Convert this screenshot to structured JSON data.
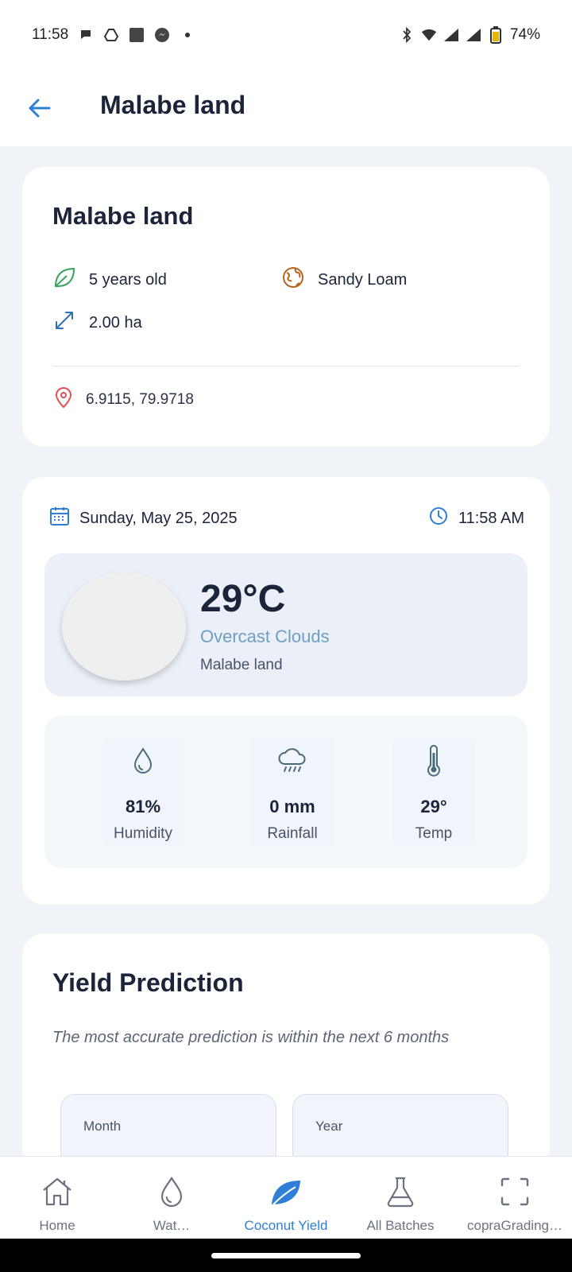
{
  "status_bar": {
    "time": "11:58",
    "battery": "74%"
  },
  "app_bar": {
    "title": "Malabe land"
  },
  "land_card": {
    "title": "Malabe land",
    "age": "5 years old",
    "soil": "Sandy Loam",
    "area": "2.00 ha",
    "coordinates": "6.9115, 79.9718"
  },
  "weather_card": {
    "date": "Sunday, May 25, 2025",
    "time": "11:58 AM",
    "temperature": "29°C",
    "description": "Overcast Clouds",
    "location": "Malabe land",
    "stats": [
      {
        "value": "81%",
        "label": "Humidity",
        "icon": "droplet-icon"
      },
      {
        "value": "0 mm",
        "label": "Rainfall",
        "icon": "rain-cloud-icon"
      },
      {
        "value": "29°",
        "label": "Temp",
        "icon": "thermometer-icon"
      }
    ]
  },
  "yield_card": {
    "title": "Yield Prediction",
    "note": "The most accurate prediction is within the next 6 months",
    "month_label": "Month",
    "year_label": "Year"
  },
  "bottom_nav": {
    "items": [
      {
        "label": "Home",
        "icon": "home-icon"
      },
      {
        "label": "Wat…",
        "icon": "water-drop-icon"
      },
      {
        "label": "Coconut Yield",
        "icon": "leaf-icon",
        "active": true
      },
      {
        "label": "All Batches",
        "icon": "flask-icon"
      },
      {
        "label": "copraGrading…",
        "icon": "scan-icon"
      }
    ]
  },
  "colors": {
    "accent": "#2f7fd6",
    "leaf_green": "#3aa35a",
    "location_red": "#e0524f",
    "globe_brown": "#b5651d"
  }
}
